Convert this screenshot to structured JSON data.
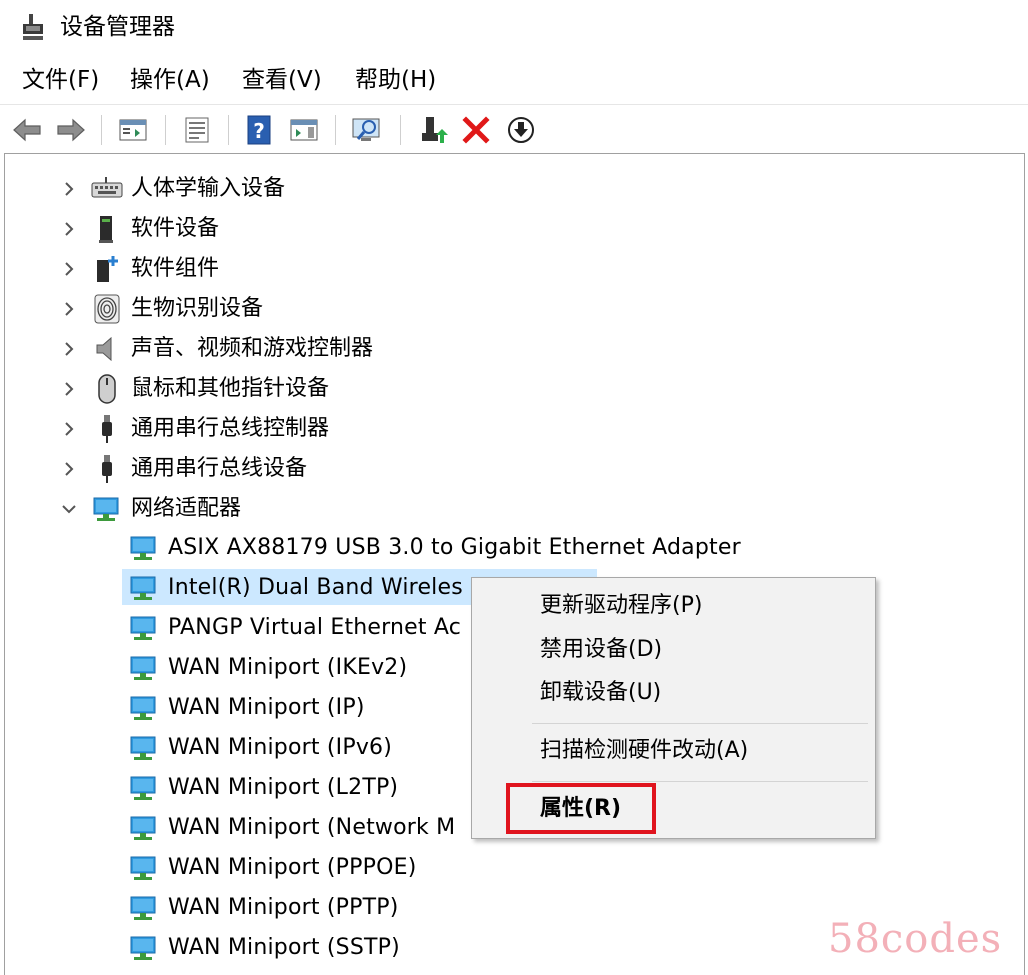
{
  "window": {
    "title": "设备管理器"
  },
  "menu": [
    "文件(F)",
    "操作(A)",
    "查看(V)",
    "帮助(H)"
  ],
  "toolbar_icons": [
    "back-arrow-icon",
    "forward-arrow-icon",
    "show-hide-tree-icon",
    "properties-sheet-icon",
    "help-icon",
    "action-pane-icon",
    "scan-hardware-icon",
    "update-driver-icon",
    "uninstall-x-icon",
    "download-driver-icon"
  ],
  "tree": {
    "categories": [
      {
        "label": "人体学输入设备",
        "icon": "keyboard-icon",
        "expanded": false
      },
      {
        "label": "软件设备",
        "icon": "software-device-icon",
        "expanded": false
      },
      {
        "label": "软件组件",
        "icon": "software-component-icon",
        "expanded": false
      },
      {
        "label": "生物识别设备",
        "icon": "fingerprint-icon",
        "expanded": false
      },
      {
        "label": "声音、视频和游戏控制器",
        "icon": "speaker-icon",
        "expanded": false
      },
      {
        "label": "鼠标和其他指针设备",
        "icon": "mouse-icon",
        "expanded": false
      },
      {
        "label": "通用串行总线控制器",
        "icon": "usb-icon",
        "expanded": false
      },
      {
        "label": "通用串行总线设备",
        "icon": "usb-icon",
        "expanded": false
      },
      {
        "label": "网络适配器",
        "icon": "network-adapter-icon",
        "expanded": true
      }
    ],
    "network_children": [
      "ASIX AX88179 USB 3.0 to Gigabit Ethernet Adapter",
      "Intel(R) Dual Band Wireles",
      "PANGP Virtual Ethernet Ac",
      "WAN Miniport (IKEv2)",
      "WAN Miniport (IP)",
      "WAN Miniport (IPv6)",
      "WAN Miniport (L2TP)",
      "WAN Miniport (Network M",
      "WAN Miniport (PPPOE)",
      "WAN Miniport (PPTP)",
      "WAN Miniport (SSTP)"
    ],
    "selected_child": "Intel(R) Dual Band Wireles"
  },
  "context_menu": {
    "items": [
      "更新驱动程序(P)",
      "禁用设备(D)",
      "卸载设备(U)",
      "扫描检测硬件改动(A)",
      "属性(R)"
    ],
    "highlighted": "属性(R)",
    "highlight_color": "#e0141e"
  },
  "watermark": "58codes",
  "colors": {
    "selection": "#cce8ff",
    "menu_bg": "#f2f2f2",
    "network_icon": "#2f9be0"
  }
}
